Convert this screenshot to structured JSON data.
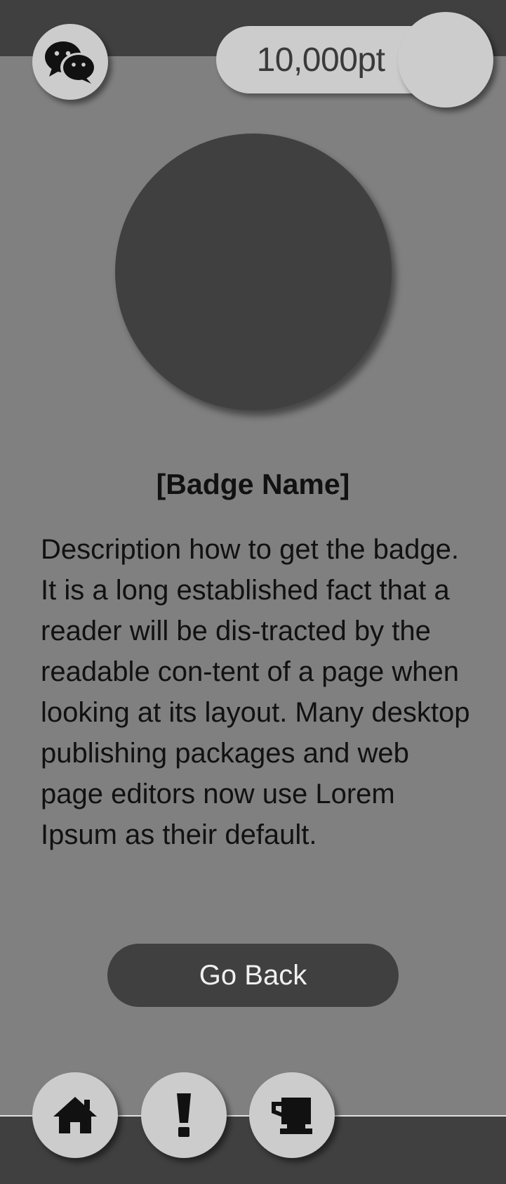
{
  "header": {
    "chat_icon": "wechat-icon",
    "points": "10,000pt",
    "avatar_icon": "avatar-placeholder"
  },
  "badge": {
    "name": "[Badge Name]",
    "description": "Description how to get the badge. It is a long established fact that a reader will be dis-tracted by the readable con-tent of a page when looking at its layout. Many desktop publishing packages and web page editors now use Lorem Ipsum as their default.",
    "go_back_label": "Go Back"
  },
  "nav": {
    "items": [
      {
        "icon": "home-icon"
      },
      {
        "icon": "exclamation-icon"
      },
      {
        "icon": "trophy-icon"
      }
    ]
  },
  "colors": {
    "background": "#808080",
    "bars": "#404040",
    "light_surface": "#cccccc",
    "text": "#111111"
  }
}
